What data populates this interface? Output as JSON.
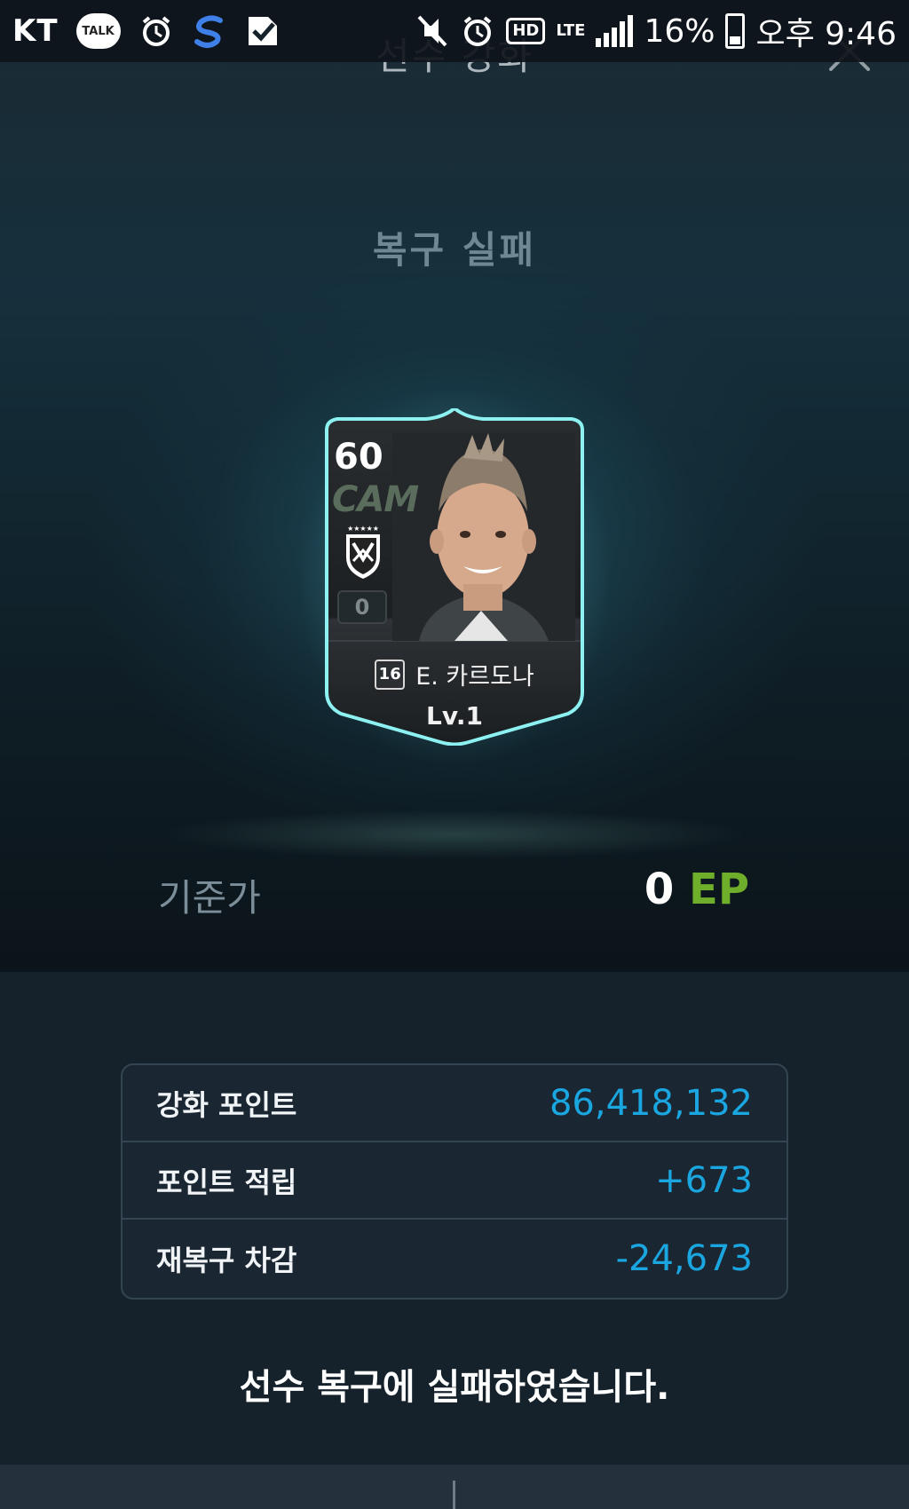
{
  "status_bar": {
    "carrier": "KT",
    "talk_label": "TALK",
    "network": "LTE",
    "hd_label": "HD",
    "battery": "16%",
    "time": "오후 9:46",
    "icons": [
      "kakaotalk-icon",
      "alarm-icon",
      "s-app-icon",
      "check-app-icon",
      "mute-icon",
      "alarm-icon",
      "hd-icon",
      "lte-icon",
      "signal-icon",
      "battery-icon"
    ]
  },
  "header": {
    "title": "선수 강화",
    "close_icon": "close-icon"
  },
  "result": {
    "title": "복구 실패",
    "message": "선수 복구에 실패하였습니다."
  },
  "player_card": {
    "overall": "60",
    "position": "CAM",
    "enhance_level": "0",
    "season": "16",
    "name": "E. 카르도나",
    "level": "Lv.1",
    "club_crest_icon": "monterrey-crest-icon",
    "glow_color": "#79e6ea"
  },
  "base_price": {
    "label": "기준가",
    "value": "0",
    "unit": "EP"
  },
  "points": [
    {
      "label": "강화 포인트",
      "value": "86,418,132"
    },
    {
      "label": "포인트 적립",
      "value": "+673"
    },
    {
      "label": "재복구 차감",
      "value": "-24,673"
    }
  ],
  "colors": {
    "accent_blue": "#1aa6e0",
    "ep_green": "#6fae2a",
    "background": "#16222b"
  }
}
